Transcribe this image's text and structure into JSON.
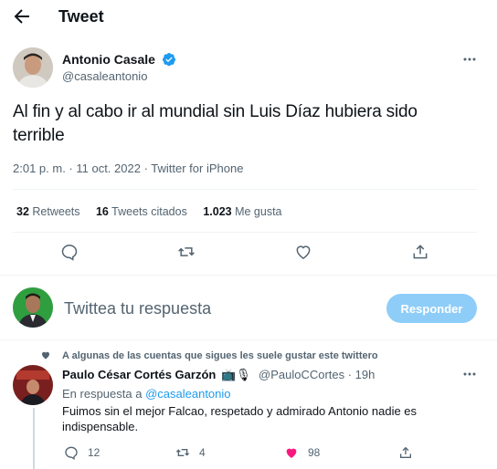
{
  "header": {
    "title": "Tweet",
    "back_icon": "arrow-left-icon"
  },
  "tweet": {
    "author_name": "Antonio Casale",
    "author_handle": "@casaleantonio",
    "text": "Al fin y al cabo ir al mundial sin Luis Díaz hubiera sido terrible",
    "meta": "2:01 p. m. · 11 oct. 2022 · Twitter for iPhone",
    "stats": {
      "retweets_count": "32",
      "retweets_label": "Retweets",
      "quotes_count": "16",
      "quotes_label": "Tweets citados",
      "likes_count": "1.023",
      "likes_label": "Me gusta"
    }
  },
  "composer": {
    "placeholder": "Twittea tu respuesta",
    "button_label": "Responder"
  },
  "reply": {
    "social_context": "A algunas de las cuentas que sigues les suele gustar este twittero",
    "name": "Paulo César Cortés Garzón",
    "handle_time": "@PauloCCortes · 19h",
    "replying_prefix": "En respuesta a",
    "replying_handle": "@casaleantonio",
    "text": "Fuimos sin el mejor Falcao, respetado y admirado Antonio nadie es indispensable.",
    "reply_count": "12",
    "retweet_count": "4",
    "like_count": "98"
  },
  "colors": {
    "accent": "#1d9bf0",
    "button_disabled": "#8ecdf8",
    "like": "#f91880",
    "muted": "#536471"
  }
}
